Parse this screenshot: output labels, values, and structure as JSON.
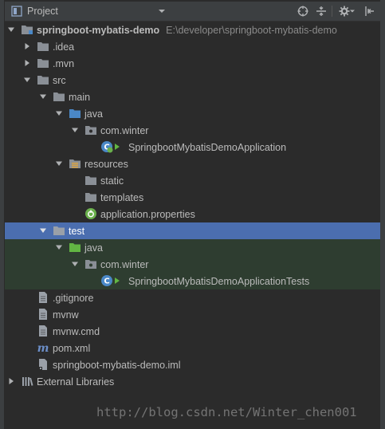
{
  "panel": {
    "view_title": "Project",
    "colors": {
      "background": "#2b2b2b",
      "toolbar": "#3c3f41",
      "selection": "#4b6eaf",
      "test_tint": "#2e3d30",
      "folder": "#8a8f96",
      "source_folder": "#4a88c7",
      "test_folder": "#62b543",
      "spring": "#6ab04c"
    }
  },
  "toolbar": {
    "icons": [
      "project-view-icon",
      "dropdown-chevron-icon",
      "locate-target-icon",
      "collapse-all-icon",
      "gear-icon",
      "hide-panel-icon"
    ]
  },
  "tree": {
    "root_label": "springboot-mybatis-demo",
    "root_path": "E:\\developer\\springboot-mybatis-demo",
    "idea": ".idea",
    "mvn": ".mvn",
    "src": "src",
    "main": "main",
    "java_main": "java",
    "pkg_main": "com.winter",
    "app_class": "SpringbootMybatisDemoApplication",
    "resources": "resources",
    "static": "static",
    "templates": "templates",
    "app_props": "application.properties",
    "test": "test",
    "java_test": "java",
    "pkg_test": "com.winter",
    "test_class": "SpringbootMybatisDemoApplicationTests",
    "gitignore": ".gitignore",
    "mvnw": "mvnw",
    "mvnw_cmd": "mvnw.cmd",
    "pom": "pom.xml",
    "iml": "springboot-mybatis-demo.iml",
    "external": "External Libraries"
  },
  "watermark": "http://blog.csdn.net/Winter_chen001"
}
